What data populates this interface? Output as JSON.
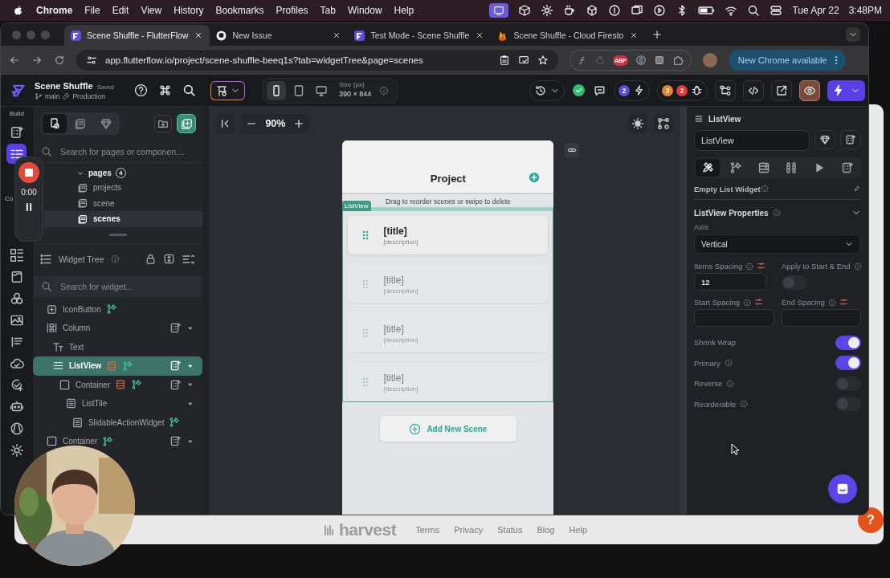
{
  "menubar": {
    "app": "Chrome",
    "menus": [
      "File",
      "Edit",
      "View",
      "History",
      "Bookmarks",
      "Profiles",
      "Tab",
      "Window",
      "Help"
    ],
    "date": "Tue Apr 22",
    "time": "3:48PM"
  },
  "browser": {
    "tabs": [
      {
        "title": "Scene Shuffle - FlutterFlow",
        "selected": true
      },
      {
        "title": "New Issue",
        "selected": false
      },
      {
        "title": "Test Mode - Scene Shuffle",
        "selected": false
      },
      {
        "title": "Scene Shuffle - Cloud Firesto",
        "selected": false
      }
    ],
    "url": "app.flutterflow.io/project/scene-shuffle-beeq1s?tab=widgetTree&page=scenes",
    "extension_badge": "ABP",
    "update_button": "New Chrome available"
  },
  "app": {
    "project": "Scene Shuffle",
    "save_state": "Saved",
    "branch": "main",
    "environment": "Production",
    "devices": [
      {
        "kind": "phone",
        "selected": true
      },
      {
        "kind": "tablet",
        "selected": false
      },
      {
        "kind": "desktop",
        "selected": false
      }
    ],
    "size_label": "Size (px)",
    "size": "390 × 844",
    "badges": [
      {
        "count": "2",
        "color": "#5a4bd8"
      },
      {
        "count": "3",
        "color": "#e8862e"
      },
      {
        "count": "2",
        "color": "#e03a3e"
      }
    ]
  },
  "rail": {
    "section": "Build",
    "label": "Co",
    "items": [
      {
        "selected": false
      },
      {
        "selected": true
      },
      {
        "selected": false
      },
      {
        "selected": false
      },
      {
        "selected": false
      },
      {
        "selected": false
      },
      {
        "selected": false
      },
      {
        "selected": false
      },
      {
        "selected": false
      },
      {
        "selected": false
      },
      {
        "selected": false
      },
      {
        "selected": false
      }
    ]
  },
  "pages_panel": {
    "tabs": [
      {
        "kind": "pages",
        "selected": true
      },
      {
        "kind": "components",
        "selected": false
      },
      {
        "kind": "library",
        "selected": false
      }
    ],
    "search": {
      "placeholder": "Search for pages or componen…"
    },
    "group": "pages",
    "count": "4",
    "pages": [
      {
        "label": "projects",
        "selected": false
      },
      {
        "label": "scene",
        "selected": false
      },
      {
        "label": "scenes",
        "selected": true
      }
    ]
  },
  "widget_tree": {
    "title": "Widget Tree",
    "search": {
      "placeholder": "Search for widget..."
    },
    "nodes": [
      {
        "label": "IconButton",
        "kind": "button",
        "selected": false,
        "action": true,
        "query": false,
        "add": false,
        "caret": false
      },
      {
        "label": "Column",
        "kind": "column",
        "selected": false,
        "action": false,
        "query": false,
        "add": true,
        "caret": true,
        "children": [
          {
            "label": "Text",
            "kind": "text",
            "selected": false,
            "action": false,
            "query": false,
            "add": false,
            "caret": false
          },
          {
            "label": "ListView",
            "kind": "list",
            "selected": true,
            "action": true,
            "query": true,
            "add": true,
            "caret": true,
            "children": [
              {
                "label": "Container",
                "kind": "container",
                "selected": false,
                "action": true,
                "query": true,
                "add": true,
                "caret": true,
                "children": [
                  {
                    "label": "ListTile",
                    "kind": "tile",
                    "selected": false,
                    "action": false,
                    "query": false,
                    "add": false,
                    "caret": true,
                    "children": [
                      {
                        "label": "SlidableActionWidget",
                        "kind": "tile",
                        "selected": false,
                        "action": true,
                        "query": false,
                        "add": false,
                        "caret": false
                      }
                    ]
                  }
                ]
              }
            ]
          }
        ]
      },
      {
        "label": "Container",
        "kind": "container",
        "selected": false,
        "action": true,
        "query": false,
        "add": true,
        "caret": true
      }
    ]
  },
  "canvas": {
    "zoom": "90%",
    "phone": {
      "title": "Project",
      "hint": "Drag to reorder scenes or swipe to delete",
      "list_tag": "ListView",
      "items": [
        {
          "title": "[title]",
          "description": "[description]",
          "faded": false
        },
        {
          "title": "[title]",
          "description": "[description]",
          "faded": true
        },
        {
          "title": "[title]",
          "description": "[description]",
          "faded": true
        },
        {
          "title": "[title]",
          "description": "[description]",
          "faded": true
        }
      ],
      "add_button": "Add New Scene"
    }
  },
  "properties": {
    "widget": "ListView",
    "name_field": "ListView",
    "tabs": [
      {
        "kind": "style",
        "selected": true
      },
      {
        "kind": "actions",
        "selected": false
      },
      {
        "kind": "backend",
        "selected": false
      },
      {
        "kind": "layout",
        "selected": false
      },
      {
        "kind": "animation",
        "selected": false
      },
      {
        "kind": "add",
        "selected": false
      }
    ],
    "collapsed_section": "Empty List Widget",
    "section": "ListView Properties",
    "axis_label": "Axis",
    "axis": "Vertical",
    "items_spacing": {
      "label": "Items Spacing",
      "value": "12"
    },
    "apply_start_end": {
      "label": "Apply to Start & End",
      "on": false
    },
    "start_spacing": {
      "label": "Start Spacing"
    },
    "end_spacing": {
      "label": "End Spacing"
    },
    "toggles": [
      {
        "label": "Shrink Wrap",
        "info": false,
        "on": true
      },
      {
        "label": "Primary",
        "info": true,
        "on": true
      },
      {
        "label": "Reverse",
        "info": true,
        "on": false
      },
      {
        "label": "Reorderable",
        "info": true,
        "on": false
      }
    ]
  },
  "recorder": {
    "timer": "0:00"
  },
  "background_window": {
    "logo": "harvest",
    "links": [
      "Terms",
      "Privacy",
      "Status",
      "Blog",
      "Help"
    ],
    "help_button": "?"
  }
}
